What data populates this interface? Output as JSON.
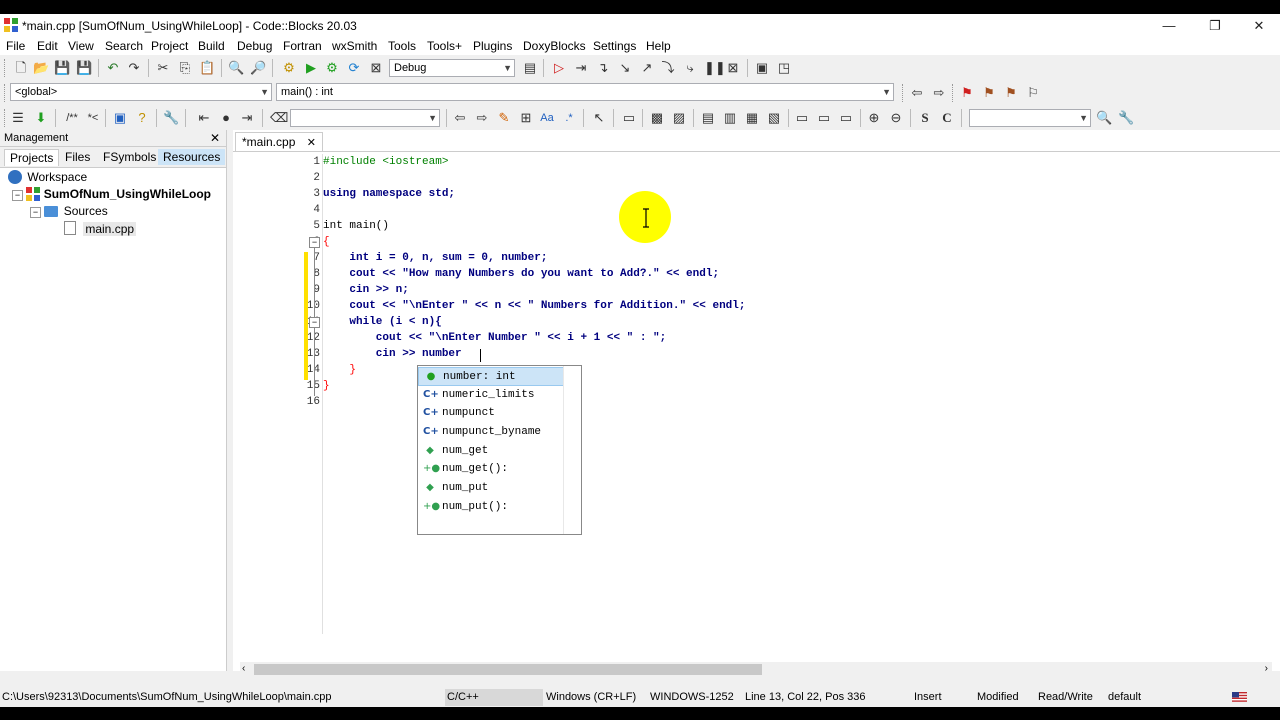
{
  "window": {
    "title": "*main.cpp [SumOfNum_UsingWhileLoop] - Code::Blocks 20.03",
    "minimize": "—",
    "maximize": "❐",
    "close": "✕"
  },
  "menu": [
    "File",
    "Edit",
    "View",
    "Search",
    "Project",
    "Build",
    "Debug",
    "Fortran",
    "wxSmith",
    "Tools",
    "Tools+",
    "Plugins",
    "DoxyBlocks",
    "Settings",
    "Help"
  ],
  "toolbar": {
    "build_target": "Debug",
    "scope": "<global>",
    "function": "main() : int"
  },
  "management": {
    "title": "Management",
    "close": "✕",
    "tabs": [
      "Projects",
      "Files",
      "FSymbols",
      "Resources"
    ],
    "tree": {
      "workspace": "Workspace",
      "project": "SumOfNum_UsingWhileLoop",
      "folder": "Sources",
      "file": "main.cpp"
    }
  },
  "editor": {
    "tab_label": "*main.cpp",
    "tab_close": "✕",
    "line_numbers": [
      "1",
      "2",
      "3",
      "4",
      "5",
      "6",
      "7",
      "8",
      "9",
      "10",
      "11",
      "12",
      "13",
      "14",
      "15",
      "16"
    ],
    "lines": [
      "#include <iostream>",
      "",
      "using namespace std;",
      "",
      "int main()",
      "{",
      "    int i = 0, n, sum = 0, number;",
      "    cout << \"How many Numbers do you want to Add?.\" << endl;",
      "    cin >> n;",
      "    cout << \"\\nEnter \" << n << \" Numbers for Addition.\" << endl;",
      "    while (i < n){",
      "        cout << \"\\nEnter Number \" << i + 1 << \" : \";",
      "        cin >> number",
      "    }",
      "}",
      ""
    ]
  },
  "autocomplete": {
    "items": [
      {
        "label": "number: int",
        "icon": "variable-icon"
      },
      {
        "label": "numeric_limits",
        "icon": "class-icon"
      },
      {
        "label": "numpunct",
        "icon": "class-icon"
      },
      {
        "label": "numpunct_byname",
        "icon": "class-icon"
      },
      {
        "label": "num_get",
        "icon": "typedef-icon"
      },
      {
        "label": "num_get():",
        "icon": "constructor-icon"
      },
      {
        "label": "num_put",
        "icon": "typedef-icon"
      },
      {
        "label": "num_put():",
        "icon": "constructor-icon"
      }
    ]
  },
  "status": {
    "path": "C:\\Users\\92313\\Documents\\SumOfNum_UsingWhileLoop\\main.cpp",
    "language": "C/C++",
    "eol": "Windows (CR+LF)",
    "encoding": "WINDOWS-1252",
    "position": "Line 13, Col 22, Pos 336",
    "mode": "Insert",
    "modified": "Modified",
    "access": "Read/Write",
    "profile": "default"
  },
  "colors": {
    "keyword": "#00007f",
    "preprocessor": "#008000",
    "string": "#0000ff",
    "number": "#ff0000",
    "selection": "#cce4f7",
    "cursor_highlight": "#ffff00"
  }
}
